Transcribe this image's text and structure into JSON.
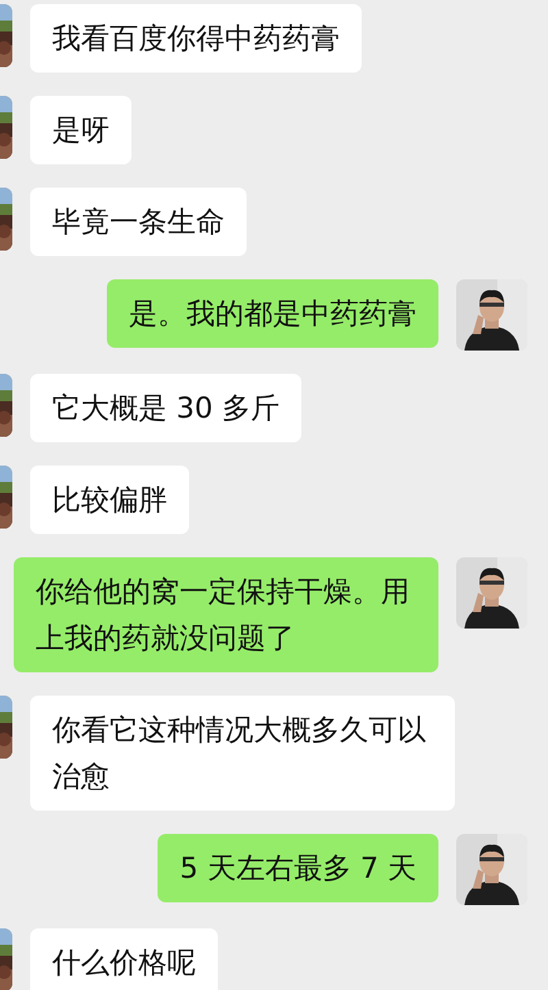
{
  "messages": [
    {
      "kind": "received",
      "text": "我看百度你得中药药膏"
    },
    {
      "kind": "received",
      "text": "是呀"
    },
    {
      "kind": "received",
      "text": "毕竟一条生命"
    },
    {
      "kind": "sent",
      "text": "是。我的都是中药药膏"
    },
    {
      "kind": "received",
      "text": "它大概是 30 多斤"
    },
    {
      "kind": "received",
      "text": "比较偏胖"
    },
    {
      "kind": "sent",
      "text": "你给他的窝一定保持干燥。用上我的药就没问题了"
    },
    {
      "kind": "received",
      "text": "你看它这种情况大概多久可以治愈"
    },
    {
      "kind": "sent",
      "text": "5 天左右最多 7 天"
    },
    {
      "kind": "received",
      "text": "什么价格呢"
    }
  ]
}
